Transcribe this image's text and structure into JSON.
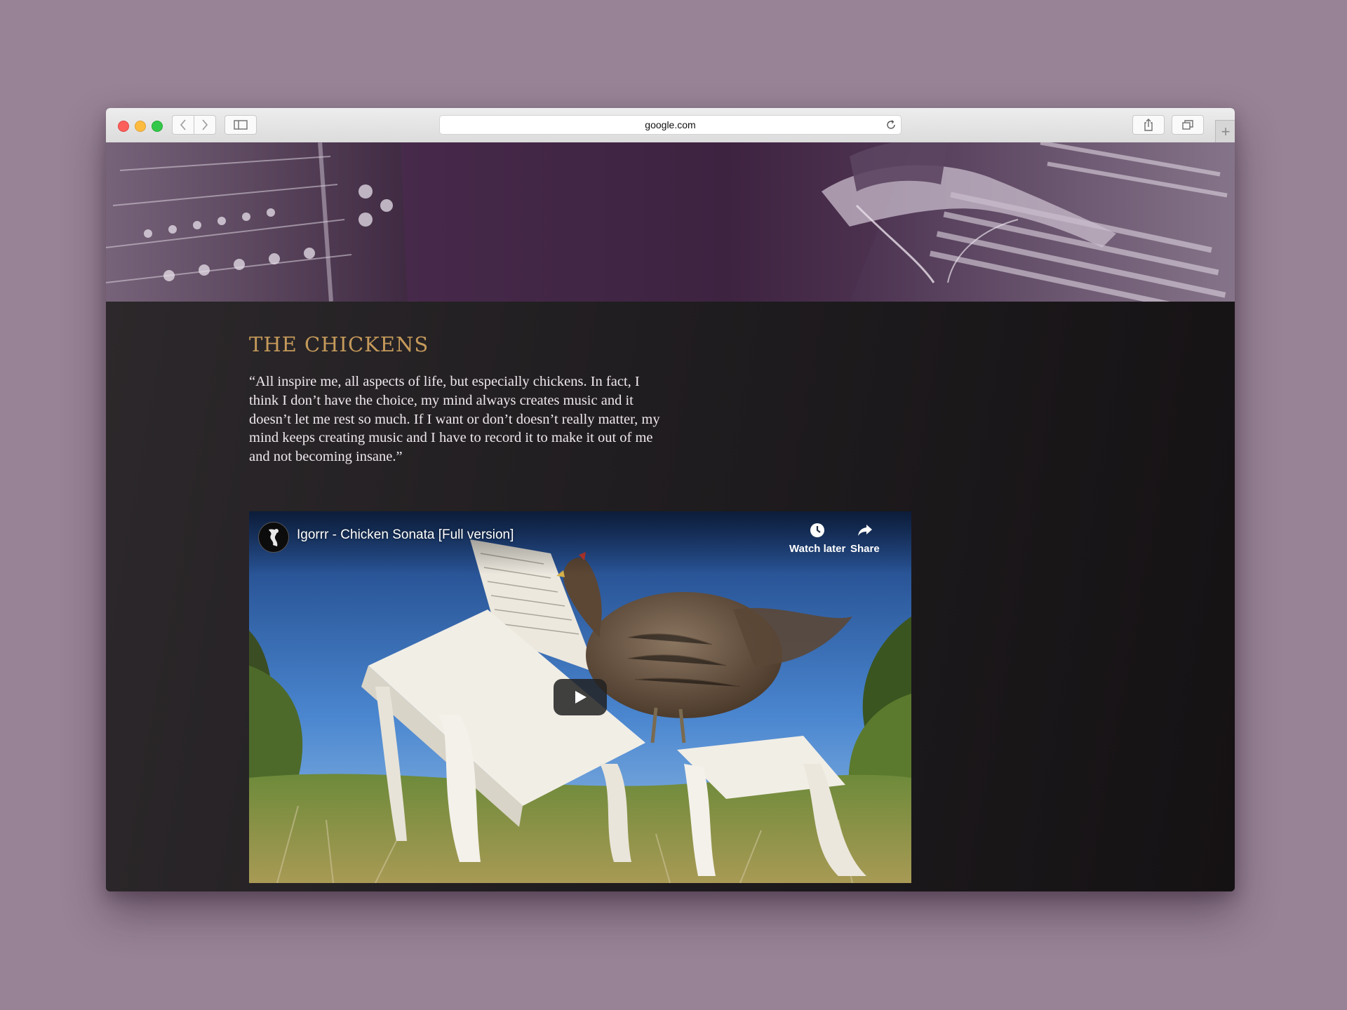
{
  "browser": {
    "url": "google.com",
    "new_tab_symbol": "+"
  },
  "section": {
    "title": "THE CHICKENS",
    "quote": "“All inspire me, all aspects of life, but especially chickens. In fact, I think I don’t have the choice, my mind always creates music and it doesn’t let me rest so much. If I want or don’t doesn’t really matter, my mind keeps creating music and I have to record it to make it out of me and not becoming insane.”"
  },
  "video": {
    "title": "Igorrr - Chicken Sonata [Full version]",
    "watch_later_label": "Watch later",
    "share_label": "Share"
  },
  "colors": {
    "page_background": "#978395",
    "section_title": "#c59a5a",
    "hero_tint": "#46294a",
    "content_background": "#201d20"
  }
}
